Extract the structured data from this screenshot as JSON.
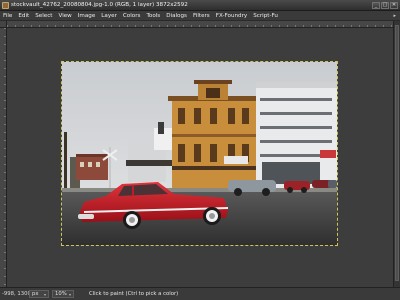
{
  "window": {
    "title": "stockvault_42762_20080804.jpg-1.0 (RGB, 1 layer) 3872x2592",
    "buttons": {
      "minimize": "_",
      "maximize": "□",
      "close": "✕"
    }
  },
  "menubar": {
    "items": [
      "File",
      "Edit",
      "Select",
      "View",
      "Image",
      "Layer",
      "Colors",
      "Tools",
      "Dialogs",
      "Filters",
      "FX-Foundry",
      "Script-Fu"
    ],
    "overflow_icon": "▸"
  },
  "statusbar": {
    "coordinates": "-998, 1300",
    "unit": "px",
    "zoom": "10%",
    "message": "Click to paint (Ctrl to pick a color)"
  },
  "icons": {
    "app": "gimp-image-icon",
    "dropdown": "▾"
  },
  "colors": {
    "selection_outline": "#cfc55a",
    "car_red": "#c8202a"
  }
}
